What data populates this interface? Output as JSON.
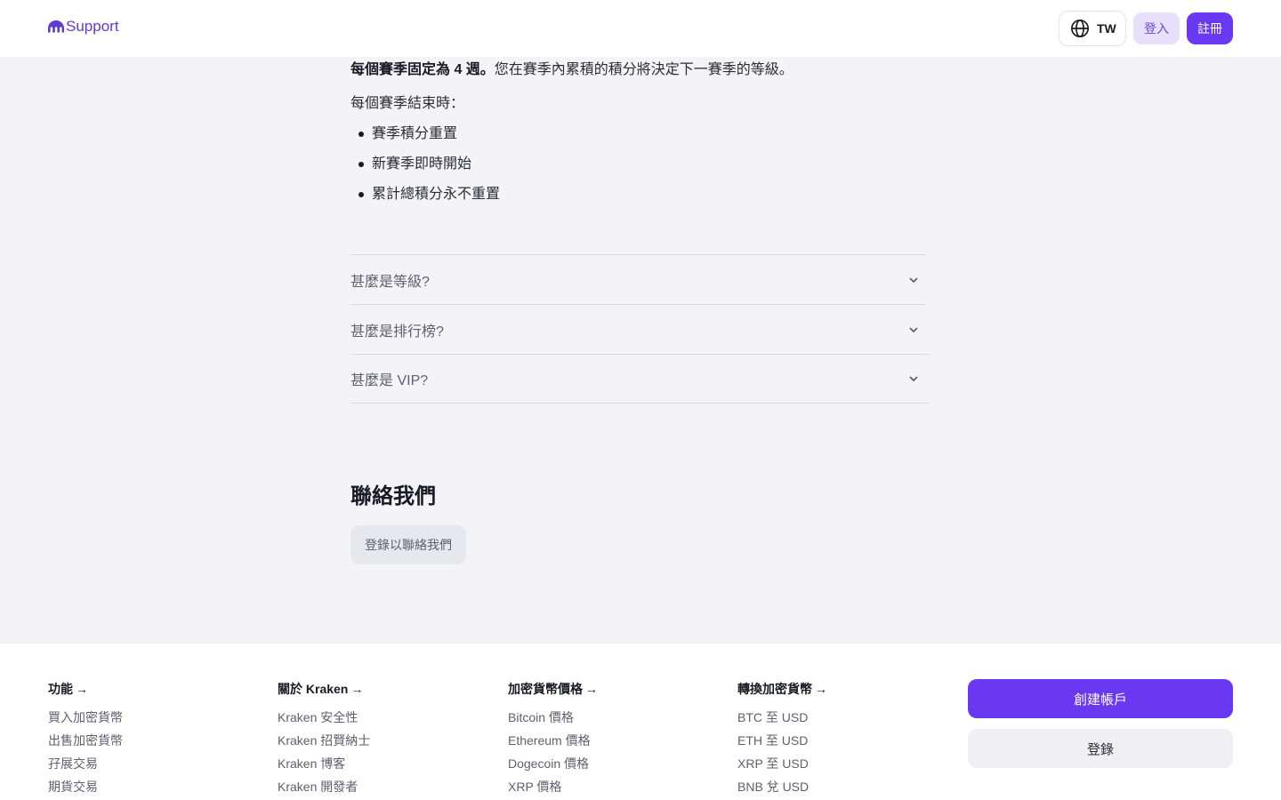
{
  "header": {
    "logo_text": "Support",
    "lang_label": "TW",
    "login_label": "登入",
    "signup_label": "註冊",
    "accent_color": "#6a38f0"
  },
  "article": {
    "season_bold": "每個賽季固定為 4 週。",
    "season_text": "您在賽季內累積的積分將決定下一賽季的等級。",
    "end_intro": "每個賽季結束時：",
    "bullets": [
      "賽季積分重置",
      "新賽季即時開始",
      "累計總積分永不重置"
    ]
  },
  "faq": [
    {
      "question": "甚麼是等級?"
    },
    {
      "question": "甚麼是排行榜?"
    },
    {
      "question": "甚麼是 VIP?"
    }
  ],
  "contact": {
    "title": "聯絡我們",
    "button_label": "登錄以聯絡我們"
  },
  "footer": {
    "columns": [
      {
        "heading": "功能",
        "links": [
          "買入加密貨幣",
          "出售加密貨幣",
          "孖展交易",
          "期貨交易"
        ]
      },
      {
        "heading": "關於 Kraken",
        "links": [
          "Kraken 安全性",
          "Kraken 招賢納士",
          "Kraken 博客",
          "Kraken 開發者"
        ]
      },
      {
        "heading": "加密貨幣價格",
        "links": [
          "Bitcoin 價格",
          "Ethereum 價格",
          "Dogecoin 價格",
          "XRP 價格"
        ]
      },
      {
        "heading": "轉換加密貨幣",
        "links": [
          "BTC 至 USD",
          "ETH 至 USD",
          "XRP 至 USD",
          "BNB 兌 USD"
        ]
      }
    ],
    "create_account_label": "創建帳戶",
    "login_label": "登錄"
  }
}
